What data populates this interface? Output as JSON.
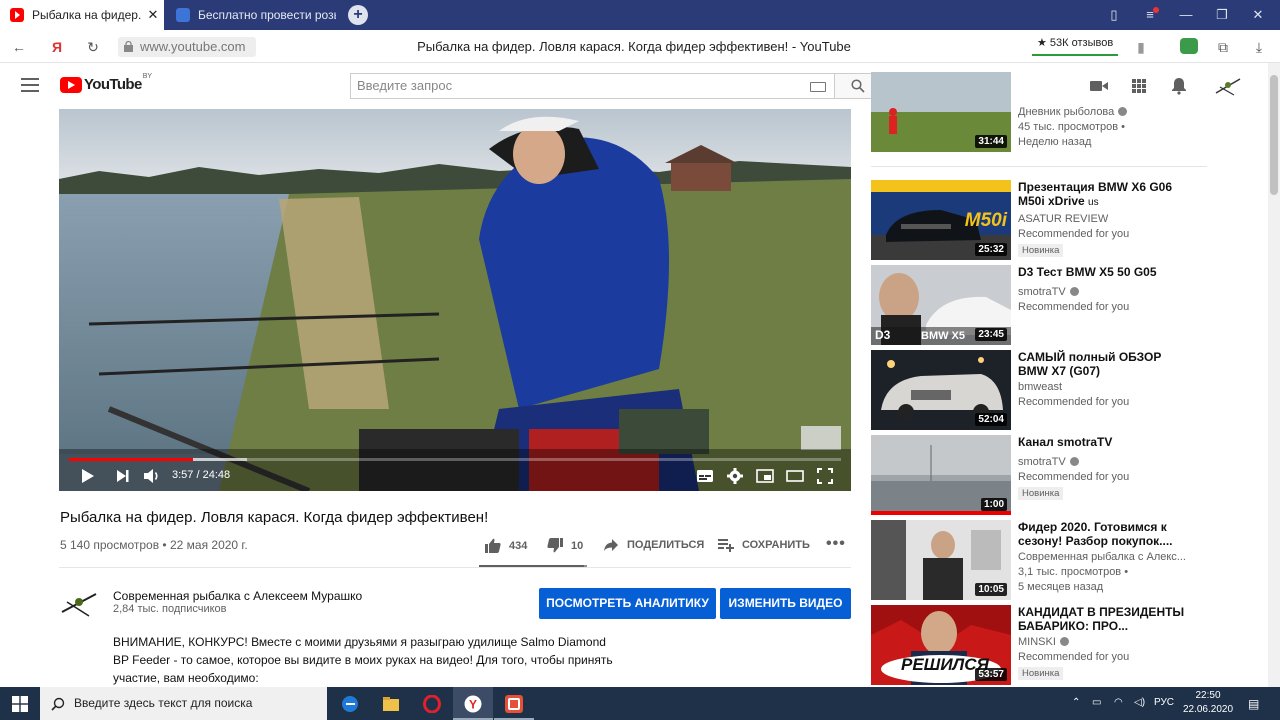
{
  "browser": {
    "tabs": [
      {
        "title": "Рыбалка на фидер. Лов",
        "active": true
      },
      {
        "title": "Бесплатно провести розы",
        "active": false
      }
    ],
    "url": "www.youtube.com",
    "page_title": "Рыбалка на фидер. Ловля карася. Когда фидер эффективен! - YouTube",
    "reviews": "★ 53К отзывов"
  },
  "youtube": {
    "logo_text": "YouTube",
    "region": "BY",
    "search_placeholder": "Введите запрос"
  },
  "player": {
    "time": "3:57 / 24:48",
    "progress": 0.16,
    "buffered": 0.23
  },
  "video": {
    "title": "Рыбалка на фидер. Ловля карася. Когда фидер эффективен!",
    "meta": "5 140 просмотров • 22 мая 2020 г.",
    "likes": "434",
    "dislikes": "10",
    "share": "ПОДЕЛИТЬСЯ",
    "save": "СОХРАНИТЬ"
  },
  "channel": {
    "name": "Современная рыбалка с Алексеем Мурашко",
    "subs": "2,84 тыс. подписчиков",
    "btn_analytics": "ПОСМОТРЕТЬ АНАЛИТИКУ",
    "btn_edit": "ИЗМЕНИТЬ ВИДЕО",
    "desc": "ВНИМАНИЕ, КОНКУРС! Вместе с моими друзьями я разыграю удилище Salmo Diamond BP Feeder - то самое, которое вы видите в моих руках на видео! Для того, чтобы принять участие, вам необходимо:"
  },
  "related": [
    {
      "title": "",
      "channel": "Дневник рыболова",
      "verified": true,
      "line3": "45 тыс. просмотров •",
      "line4": "Неделю назад",
      "duration": "31:44",
      "badge": ""
    },
    {
      "title": "Презентация BMW X6 G06 M50i xDrive",
      "title_suffix": "us",
      "channel": "ASATUR REVIEW",
      "verified": false,
      "line3": "Recommended for you",
      "line4": "",
      "duration": "25:32",
      "badge": "Новинка"
    },
    {
      "title": "D3 Тест BMW X5 50 G05",
      "channel": "smotraTV",
      "verified": true,
      "line3": "Recommended for you",
      "line4": "",
      "duration": "23:45",
      "badge": ""
    },
    {
      "title": "САМЫЙ полный ОБЗОР BMW X7 (G07)",
      "channel": "bmweast",
      "verified": false,
      "line3": "Recommended for you",
      "line4": "",
      "duration": "52:04",
      "badge": ""
    },
    {
      "title": "Канал smotraTV",
      "channel": "smotraTV",
      "verified": true,
      "line3": "Recommended for you",
      "line4": "",
      "duration": "1:00",
      "badge": "Новинка"
    },
    {
      "title": "Фидер 2020. Готовимся к сезону! Разбор покупок....",
      "channel": "Современная рыбалка с Алекс...",
      "verified": false,
      "line3": "3,1 тыс. просмотров •",
      "line4": "5 месяцев назад",
      "duration": "10:05",
      "badge": ""
    },
    {
      "title": "КАНДИДАТ В ПРЕЗИДЕНТЫ БАБАРИКО: ПРО...",
      "channel": "MINSKI",
      "verified": true,
      "line3": "Recommended for you",
      "line4": "",
      "duration": "53:57",
      "badge": "Новинка"
    }
  ],
  "thumb_text": {
    "x6_caption": "M50i",
    "x5_tag": "D3",
    "x5_model": "BMW X5",
    "babariko_caption": "РЕШИЛСЯ"
  },
  "taskbar": {
    "search": "Введите здесь текст для поиска",
    "lang": "РУС",
    "time": "22:50",
    "date": "22.06.2020"
  }
}
